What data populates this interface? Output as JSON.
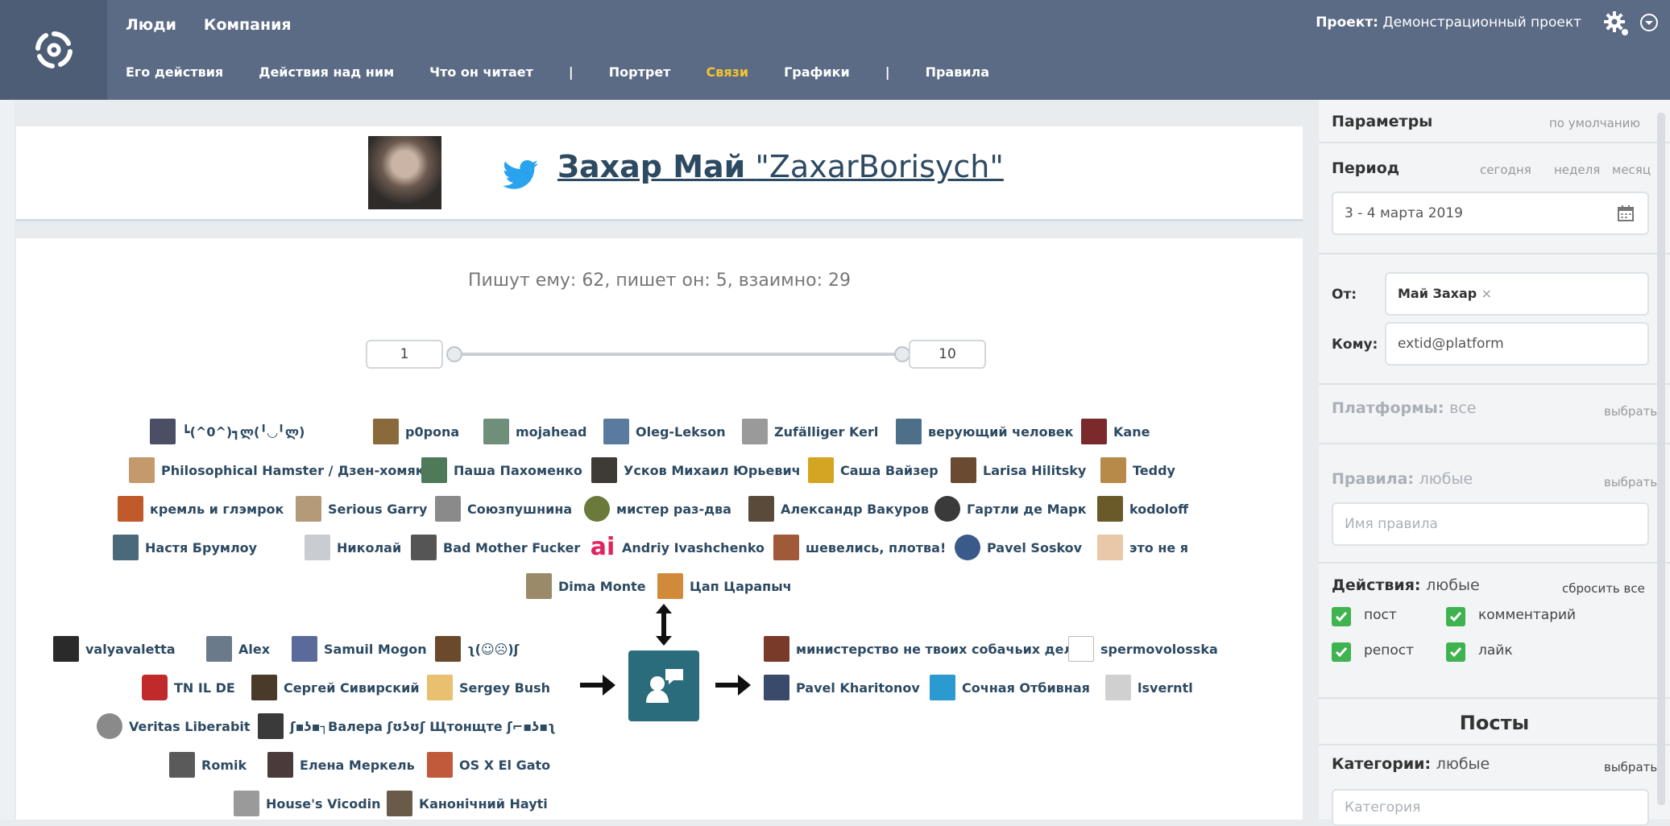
{
  "nav": {
    "primary": [
      "Люди",
      "Компания"
    ],
    "secondary": [
      "Его действия",
      "Действия над ним",
      "Что он читает",
      "|",
      "Портрет",
      "Связи",
      "Графики",
      "|",
      "Правила"
    ],
    "active_secondary": "Связи",
    "project_label": "Проект:",
    "project_name": "Демонстрационный проект"
  },
  "profile": {
    "name": "Захар Май",
    "handle": "\"ZaxarBorisych\""
  },
  "graph": {
    "summary": "Пишут ему: 62, пишет он: 5, взаимно: 29",
    "range_min": "1",
    "range_max": "10",
    "top_nodes": [
      "┗(^0^)┓ლ(╹◡╹ლ)",
      "p0pona",
      "mojahead",
      "Oleg-Lekson",
      "Zufälliger Kerl",
      "верующий человек",
      "Kane",
      "Philosophical Hamster / Дзен-хомяк",
      "Паша Пахоменко",
      "Усков Михаил Юрьевич",
      "Саша Вайзер",
      "Larisa Hilitsky",
      "Teddy",
      "кремль и глэмрок",
      "Serious Garry",
      "Союзпушнина",
      "мистер раз-два",
      "Александр Вакуров",
      "Гартли де Марк",
      "kodoloff",
      "Настя Брумлоу",
      "Николай",
      "Bad Mother Fucker",
      "Andriy Ivashchenko",
      "шевелись, плотва!",
      "Pavel Soskov",
      "это не я",
      "Dima Monte",
      "Цап Царапыч"
    ],
    "left_nodes": [
      "valyavaletta",
      "Alex",
      "Samuil Mogon",
      "ʅ(☺︎☹︎)ʃ",
      "TN IL DE",
      "Сергей Сивирский",
      "Sergey Bush",
      "Veritas Liberabit",
      "ʃ▪︎ʖ▪︎┐Валера ʃʊʖʊʃ Щтонщте ʃ⌐▪︎ʖ▪︎ʅ",
      "Romik",
      "Елена Меркель",
      "OS X El Gato",
      "House's Vicodin",
      "Канонічний Hayti"
    ],
    "right_nodes": [
      "министерство не твоих собачьих дел",
      "spermovolosska",
      "Pavel Kharitonov",
      "Сочная Отбивная",
      "lsverntl"
    ]
  },
  "sidebar": {
    "params_title": "Параметры",
    "params_default": "по умолчанию",
    "period_title": "Период",
    "period_today": "сегодня",
    "period_week": "неделя",
    "period_month": "месяц",
    "period_value": "3 - 4 марта 2019",
    "from_label": "От:",
    "from_tag": "Май Захар",
    "to_label": "Кому:",
    "to_value": "extid@platform",
    "platforms_label": "Платформы:",
    "platforms_value": "все",
    "platforms_choose": "выбрать",
    "rules_label": "Правила:",
    "rules_value": "любые",
    "rules_choose": "выбрать",
    "rules_placeholder": "Имя правила",
    "actions_label": "Действия:",
    "actions_value": "любые",
    "actions_reset": "сбросить все",
    "actions": [
      "пост",
      "комментарий",
      "репост",
      "лайк"
    ],
    "posts_title": "Посты",
    "categories_label": "Категории:",
    "categories_value": "любые",
    "categories_choose": "выбрать",
    "categories_placeholder": "Категория"
  }
}
